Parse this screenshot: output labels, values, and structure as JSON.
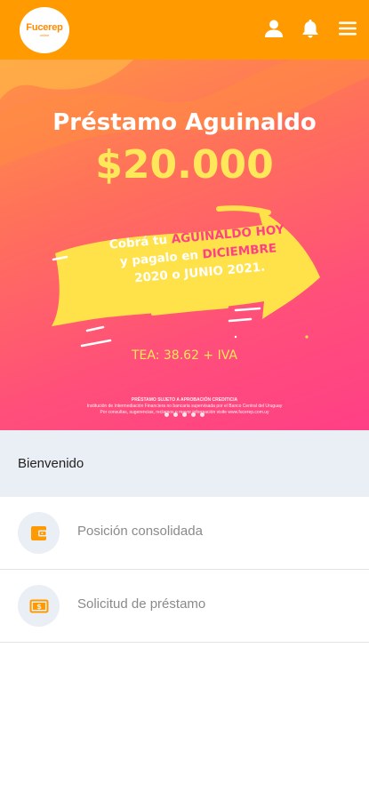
{
  "header": {
    "logo_text": "Fucerep",
    "logo_sub": "online",
    "icons": [
      "user-icon",
      "bell-icon",
      "menu-icon"
    ],
    "background_color": "#ff9a00"
  },
  "banner": {
    "title": "Préstamo Aguinaldo",
    "amount": "$20.000",
    "arrow_line1_a": "Cobrá tu ",
    "arrow_line1_b": "AGUINALDO HOY",
    "arrow_line2_a": "y pagalo en ",
    "arrow_line2_b": "DICIEMBRE",
    "arrow_line3": "2020 o JUNIO 2021.",
    "tea": "TEA: 38.62 + IVA",
    "fine_print_title": "PRÉSTAMO SUJETO A APROBACIÓN CREDITICIA",
    "fine_print_line1": "Institución de Intermediación Financiera no bancaria supervisada por el Banco Central del Uruguay",
    "fine_print_line2": "Por consultas, sugerencias, reclamos o mayor información visite www.fucerep.com.uy",
    "carousel_dots": 5
  },
  "welcome": {
    "text": "Bienvenido"
  },
  "menu": {
    "items": [
      {
        "label": "Posición consolidada",
        "icon": "wallet-icon"
      },
      {
        "label": "Solicitud de préstamo",
        "icon": "dollar-bill-icon"
      }
    ],
    "accent_color": "#ff9a00"
  }
}
